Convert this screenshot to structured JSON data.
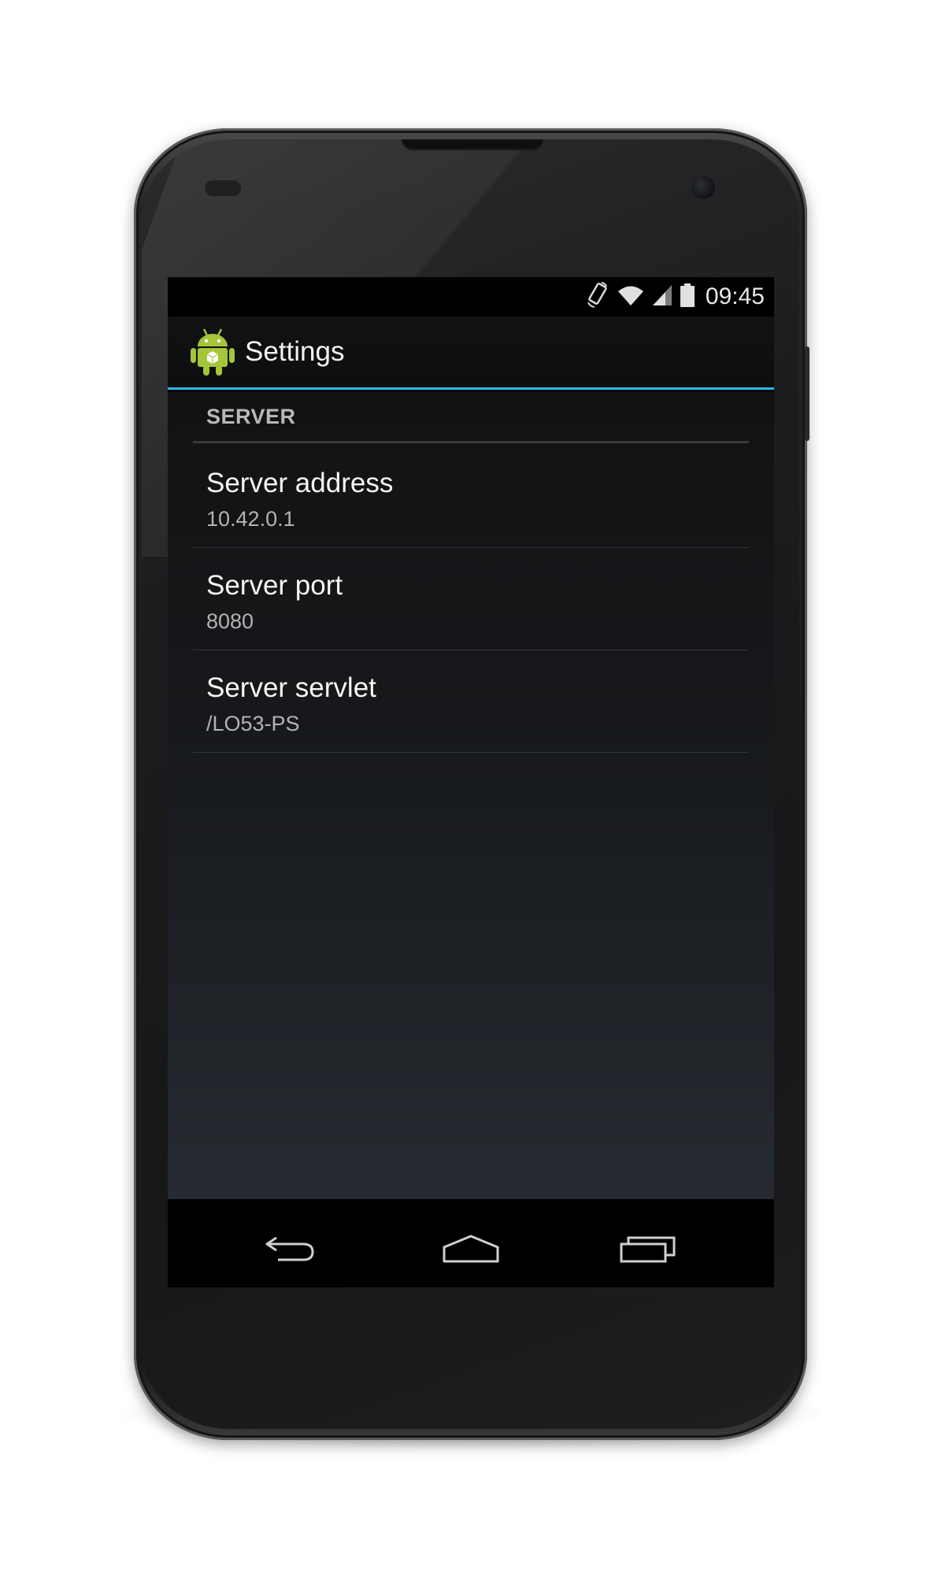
{
  "status_bar": {
    "time": "09:45",
    "icons": [
      "rotate-icon",
      "wifi-icon",
      "signal-icon",
      "battery-icon"
    ]
  },
  "action_bar": {
    "title": "Settings",
    "icon": "android-app-icon"
  },
  "settings": {
    "category": "SERVER",
    "items": [
      {
        "title": "Server address",
        "summary": "10.42.0.1"
      },
      {
        "title": "Server port",
        "summary": "8080"
      },
      {
        "title": "Server servlet",
        "summary": "/LO53-PS"
      }
    ]
  },
  "nav_bar": {
    "buttons": [
      "back-icon",
      "home-icon",
      "recent-apps-icon"
    ]
  },
  "colors": {
    "accent": "#33b5e5",
    "android_green": "#a4c639"
  }
}
